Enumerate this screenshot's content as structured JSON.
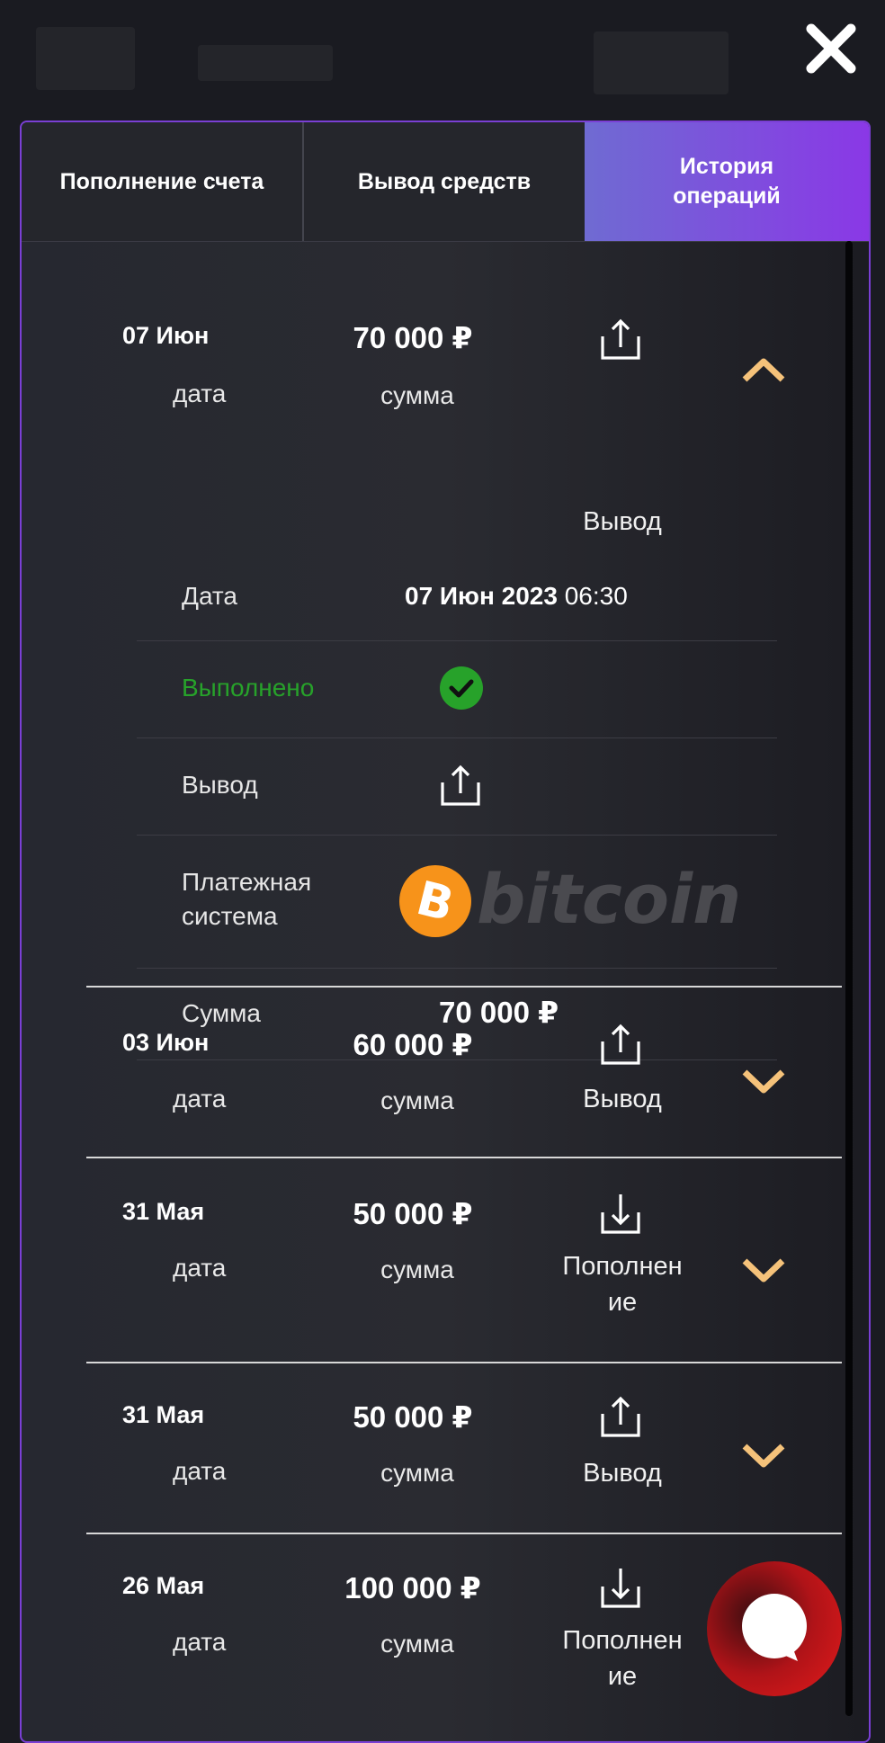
{
  "close_label": "×",
  "tabs": [
    "Пополнение счета",
    "Вывод средств",
    "История операций"
  ],
  "expanded": {
    "date": "07 Июн",
    "date_label": "дата",
    "amount": "70 000 ₽",
    "amount_label": "сумма",
    "type": "Вывод",
    "details": {
      "date_label": "Дата",
      "date_bold": "07 Июн 2023",
      "time": "06:30",
      "status": "Выполнено",
      "type_label": "Вывод",
      "payment_label": "Платежная система",
      "payment_brand": "bitcoin",
      "sum_label": "Сумма",
      "sum_value": "70 000 ₽"
    }
  },
  "operations": [
    {
      "date": "03 Июн",
      "date_label": "дата",
      "amount": "60 000 ₽",
      "amount_label": "сумма",
      "type": "Вывод",
      "icon": "upload-icon"
    },
    {
      "date": "31 Мая",
      "date_label": "дата",
      "amount": "50 000 ₽",
      "amount_label": "сумма",
      "type": "Пополнение",
      "icon": "download-icon"
    },
    {
      "date": "31 Мая",
      "date_label": "дата",
      "amount": "50 000 ₽",
      "amount_label": "сумма",
      "type": "Вывод",
      "icon": "upload-icon"
    },
    {
      "date": "26 Мая",
      "date_label": "дата",
      "amount": "100 000 ₽",
      "amount_label": "сумма",
      "type": "Пополнение",
      "icon": "download-icon"
    }
  ],
  "colors": {
    "accent_purple": "#8a38e6",
    "chevron": "#f5c27a",
    "status_green": "#27a22a",
    "bitcoin_orange": "#f7931a",
    "fab_red": "#e31b1b"
  }
}
